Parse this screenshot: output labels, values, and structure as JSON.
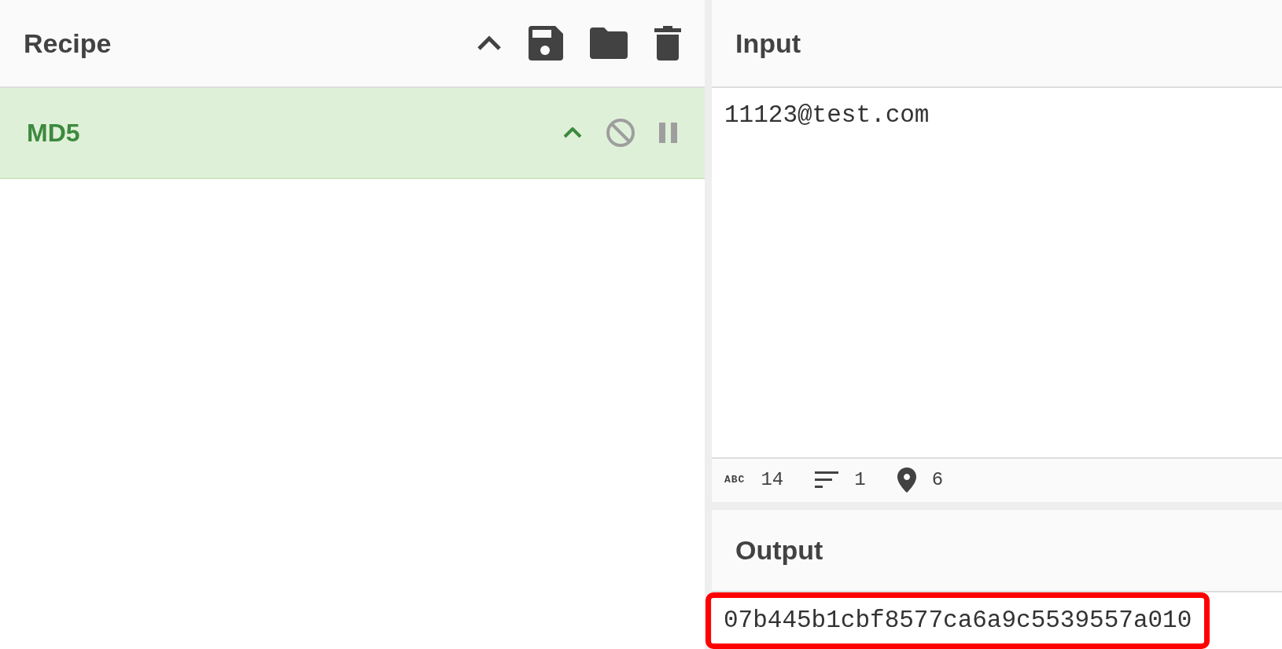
{
  "recipe": {
    "title": "Recipe",
    "operations": [
      {
        "name": "MD5",
        "disabled": false,
        "paused": false
      }
    ]
  },
  "input": {
    "title": "Input",
    "value": "11123@test.com",
    "status": [
      {
        "kind": "length",
        "label": "ABC",
        "value": "14"
      },
      {
        "kind": "lines",
        "value": "1"
      },
      {
        "kind": "position",
        "value": "6"
      }
    ]
  },
  "output": {
    "title": "Output",
    "value": "07b445b1cbf8577ca6a9c5539557a010",
    "highlighted": true
  }
}
